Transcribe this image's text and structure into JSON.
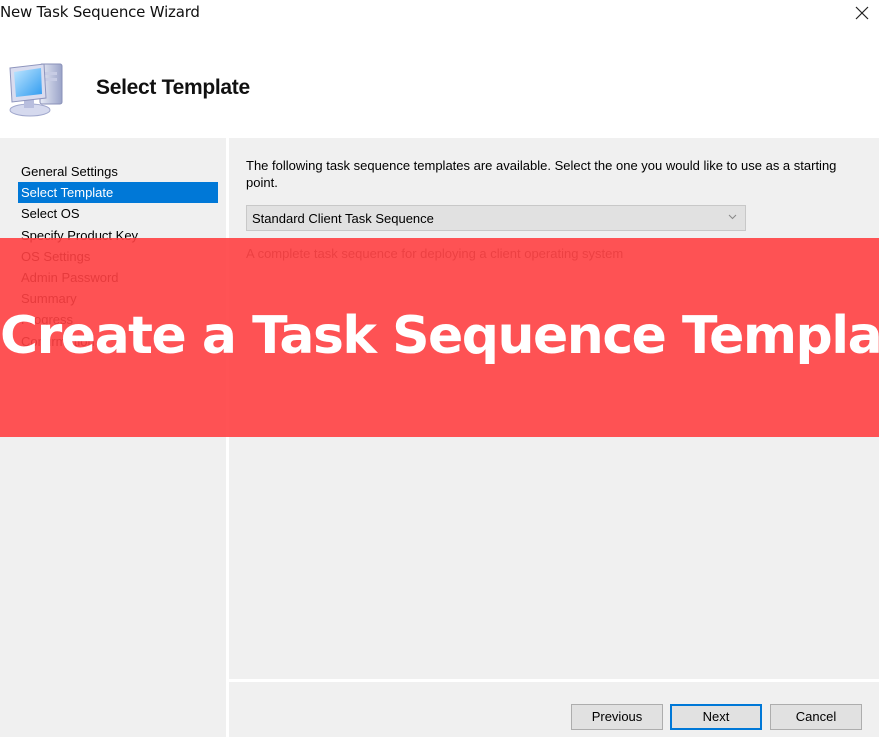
{
  "window": {
    "title": "New Task Sequence Wizard",
    "close_icon": "close-x-icon"
  },
  "header": {
    "icon": "computer-icon",
    "title": "Select Template"
  },
  "nav": {
    "items": [
      {
        "label": "General Settings",
        "state": "done"
      },
      {
        "label": "Select Template",
        "state": "selected"
      },
      {
        "label": "Select OS",
        "state": "pending"
      },
      {
        "label": "Specify Product Key",
        "state": "pending"
      },
      {
        "label": "OS Settings",
        "state": "pending"
      },
      {
        "label": "Admin Password",
        "state": "pending"
      },
      {
        "label": "Summary",
        "state": "pending"
      },
      {
        "label": "Progress",
        "state": "pending"
      },
      {
        "label": "Confirmation",
        "state": "pending"
      }
    ]
  },
  "main": {
    "intro_text": "The following task sequence templates are available.  Select the one you would like to use as a starting point.",
    "template_select": {
      "value": "Standard Client Task Sequence",
      "chevron_icon": "chevron-down-icon"
    },
    "description": "A complete task sequence for deploying a client operating system"
  },
  "footer": {
    "previous_label": "Previous",
    "next_label": "Next",
    "cancel_label": "Cancel"
  },
  "overlay": {
    "banner_text": "Create a Task Sequence Template",
    "banner_color": "#ff4042"
  },
  "colors": {
    "selection": "#0078d7",
    "panel_bg": "#f0f0f0",
    "button_bg": "#e1e1e1"
  }
}
